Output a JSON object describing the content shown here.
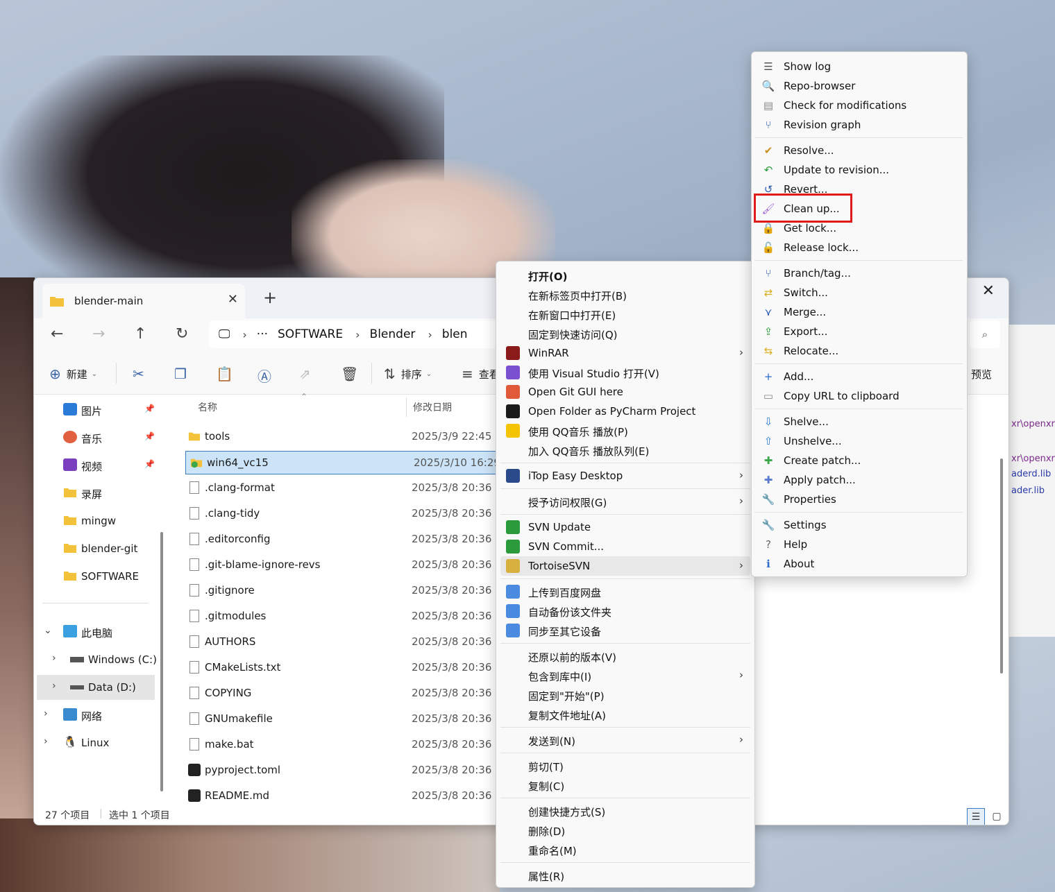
{
  "window": {
    "tab_title": "blender-main",
    "address": {
      "root": "···",
      "crumbs": [
        "SOFTWARE",
        "Blender",
        "blen"
      ]
    }
  },
  "toolbar": {
    "new": "新建",
    "sort": "排序",
    "view": "查看",
    "preview": "预览"
  },
  "sidebar": {
    "quick": [
      {
        "label": "图片",
        "pinned": true,
        "icon": "pictures-icon"
      },
      {
        "label": "音乐",
        "pinned": true,
        "icon": "music-icon"
      },
      {
        "label": "视频",
        "pinned": true,
        "icon": "video-icon"
      },
      {
        "label": "录屏",
        "pinned": false,
        "icon": "folder-icon"
      },
      {
        "label": "mingw",
        "pinned": false,
        "icon": "folder-icon"
      },
      {
        "label": "blender-git",
        "pinned": false,
        "icon": "folder-icon"
      },
      {
        "label": "SOFTWARE",
        "pinned": false,
        "icon": "folder-icon"
      }
    ],
    "tree": [
      {
        "label": "此电脑",
        "icon": "computer-icon",
        "chevron": "⌄"
      },
      {
        "label": "Windows (C:)",
        "icon": "drive-icon",
        "chevron": "›"
      },
      {
        "label": "Data (D:)",
        "icon": "drive-icon",
        "chevron": "›"
      },
      {
        "label": "网络",
        "icon": "network-icon",
        "chevron": "›"
      },
      {
        "label": "Linux",
        "icon": "linux-icon",
        "chevron": "›"
      }
    ]
  },
  "filelist": {
    "columns": {
      "name": "名称",
      "date": "修改日期"
    },
    "rows": [
      {
        "name": "tools",
        "date": "2025/3/9 22:45",
        "type": "folder"
      },
      {
        "name": "win64_vc15",
        "date": "2025/3/10 16:29",
        "type": "svn-folder"
      },
      {
        "name": ".clang-format",
        "date": "2025/3/8 20:36",
        "type": "file"
      },
      {
        "name": ".clang-tidy",
        "date": "2025/3/8 20:36",
        "type": "file"
      },
      {
        "name": ".editorconfig",
        "date": "2025/3/8 20:36",
        "type": "file"
      },
      {
        "name": ".git-blame-ignore-revs",
        "date": "2025/3/8 20:36",
        "type": "file"
      },
      {
        "name": ".gitignore",
        "date": "2025/3/8 20:36",
        "type": "file"
      },
      {
        "name": ".gitmodules",
        "date": "2025/3/8 20:36",
        "type": "file"
      },
      {
        "name": "AUTHORS",
        "date": "2025/3/8 20:36",
        "type": "file"
      },
      {
        "name": "CMakeLists.txt",
        "date": "2025/3/8 20:36",
        "type": "file"
      },
      {
        "name": "COPYING",
        "date": "2025/3/8 20:36",
        "type": "file"
      },
      {
        "name": "GNUmakefile",
        "date": "2025/3/8 20:36",
        "type": "file"
      },
      {
        "name": "make.bat",
        "date": "2025/3/8 20:36",
        "type": "bat"
      },
      {
        "name": "pyproject.toml",
        "date": "2025/3/8 20:36",
        "type": "toml"
      },
      {
        "name": "README.md",
        "date": "2025/3/8 20:36",
        "type": "toml"
      }
    ]
  },
  "status": {
    "count": "27 个项目",
    "selected": "选中 1 个项目"
  },
  "background_window": {
    "lines": [
      "xr\\openxr",
      "xr\\openxr",
      "aderd.lib",
      "ader.lib"
    ]
  },
  "context_menu": {
    "groups": [
      [
        {
          "label": "打开(O)",
          "bold": true
        },
        {
          "label": "在新标签页中打开(B)"
        },
        {
          "label": "在新窗口中打开(E)"
        },
        {
          "label": "固定到快速访问(Q)"
        },
        {
          "label": "WinRAR",
          "icon": "winrar-icon",
          "color": "#8b1a1a",
          "submenu": true
        },
        {
          "label": "使用 Visual Studio 打开(V)",
          "icon": "visual-studio-icon",
          "color": "#7a4fd0"
        },
        {
          "label": "Open Git GUI here",
          "icon": "git-gui-icon",
          "color": "#e05a3a"
        },
        {
          "label": "Open Folder as PyCharm Project",
          "icon": "pycharm-icon",
          "color": "#1a1a1a"
        },
        {
          "label": "使用 QQ音乐 播放(P)",
          "icon": "qqmusic-icon",
          "color": "#f5c400"
        },
        {
          "label": "加入 QQ音乐 播放队列(E)"
        }
      ],
      [
        {
          "label": "iTop Easy Desktop",
          "icon": "itop-icon",
          "color": "#2a4a8a",
          "submenu": true
        }
      ],
      [
        {
          "label": "授予访问权限(G)",
          "submenu": true
        }
      ],
      [
        {
          "label": "SVN Update",
          "icon": "svn-update-icon",
          "color": "#2a9a3a"
        },
        {
          "label": "SVN Commit...",
          "icon": "svn-commit-icon",
          "color": "#2a9a3a"
        },
        {
          "label": "TortoiseSVN",
          "icon": "tortoisesvn-icon",
          "color": "#d8b040",
          "submenu": true,
          "hover": true
        }
      ],
      [
        {
          "label": "上传到百度网盘",
          "icon": "baidu-icon",
          "color": "#4a8ae0"
        },
        {
          "label": "自动备份该文件夹",
          "icon": "baidu-icon",
          "color": "#4a8ae0"
        },
        {
          "label": "同步至其它设备",
          "icon": "baidu-icon",
          "color": "#4a8ae0"
        }
      ],
      [
        {
          "label": "还原以前的版本(V)"
        },
        {
          "label": "包含到库中(I)",
          "submenu": true
        },
        {
          "label": "固定到\"开始\"(P)"
        },
        {
          "label": "复制文件地址(A)"
        }
      ],
      [
        {
          "label": "发送到(N)",
          "submenu": true
        }
      ],
      [
        {
          "label": "剪切(T)"
        },
        {
          "label": "复制(C)"
        }
      ],
      [
        {
          "label": "创建快捷方式(S)"
        },
        {
          "label": "删除(D)"
        },
        {
          "label": "重命名(M)"
        }
      ],
      [
        {
          "label": "属性(R)"
        }
      ]
    ]
  },
  "tortoise_submenu": {
    "groups": [
      [
        {
          "label": "Show log",
          "icon": "log-icon",
          "glyph": "☰",
          "color": "#555"
        },
        {
          "label": "Repo-browser",
          "icon": "repo-browser-icon",
          "glyph": "🔍",
          "color": "#d8a020"
        },
        {
          "label": "Check for modifications",
          "icon": "check-modifications-icon",
          "glyph": "▤",
          "color": "#888"
        },
        {
          "label": "Revision graph",
          "icon": "revision-graph-icon",
          "glyph": "⑂",
          "color": "#2a5ab0"
        }
      ],
      [
        {
          "label": "Resolve...",
          "icon": "resolve-icon",
          "glyph": "✔",
          "color": "#c89020"
        },
        {
          "label": "Update to revision...",
          "icon": "update-icon",
          "glyph": "↶",
          "color": "#2a9a3a"
        },
        {
          "label": "Revert...",
          "icon": "revert-icon",
          "glyph": "↺",
          "color": "#2a5ab0"
        },
        {
          "label": "Clean up...",
          "icon": "cleanup-icon",
          "glyph": "🖌",
          "color": "#a060d0"
        },
        {
          "label": "Get lock...",
          "icon": "lock-icon",
          "glyph": "🔒",
          "color": "#d8a020"
        },
        {
          "label": "Release lock...",
          "icon": "unlock-icon",
          "glyph": "🔓",
          "color": "#d8a020"
        }
      ],
      [
        {
          "label": "Branch/tag...",
          "icon": "branch-icon",
          "glyph": "⑂",
          "color": "#2a5ab0"
        },
        {
          "label": "Switch...",
          "icon": "switch-icon",
          "glyph": "⇄",
          "color": "#d8b020"
        },
        {
          "label": "Merge...",
          "icon": "merge-icon",
          "glyph": "⋎",
          "color": "#2a5ab0"
        },
        {
          "label": "Export...",
          "icon": "export-icon",
          "glyph": "⇪",
          "color": "#2a9a3a"
        },
        {
          "label": "Relocate...",
          "icon": "relocate-icon",
          "glyph": "⇆",
          "color": "#d8b020"
        }
      ],
      [
        {
          "label": "Add...",
          "icon": "add-icon",
          "glyph": "+",
          "color": "#2a6ad0"
        },
        {
          "label": "Copy URL to clipboard",
          "icon": "copy-url-icon",
          "glyph": "▭",
          "color": "#888"
        }
      ],
      [
        {
          "label": "Shelve...",
          "icon": "shelve-icon",
          "glyph": "⇩",
          "color": "#2a7ad0"
        },
        {
          "label": "Unshelve...",
          "icon": "unshelve-icon",
          "glyph": "⇧",
          "color": "#2a7ad0"
        },
        {
          "label": "Create patch...",
          "icon": "create-patch-icon",
          "glyph": "✚",
          "color": "#3aa84a"
        },
        {
          "label": "Apply patch...",
          "icon": "apply-patch-icon",
          "glyph": "✚",
          "color": "#5a7ad0"
        },
        {
          "label": "Properties",
          "icon": "properties-icon",
          "glyph": "🔧",
          "color": "#888"
        }
      ],
      [
        {
          "label": "Settings",
          "icon": "settings-icon",
          "glyph": "🔧",
          "color": "#888"
        },
        {
          "label": "Help",
          "icon": "help-icon",
          "glyph": "?",
          "color": "#666"
        },
        {
          "label": "About",
          "icon": "about-icon",
          "glyph": "ℹ",
          "color": "#2a6ad0"
        }
      ]
    ]
  }
}
